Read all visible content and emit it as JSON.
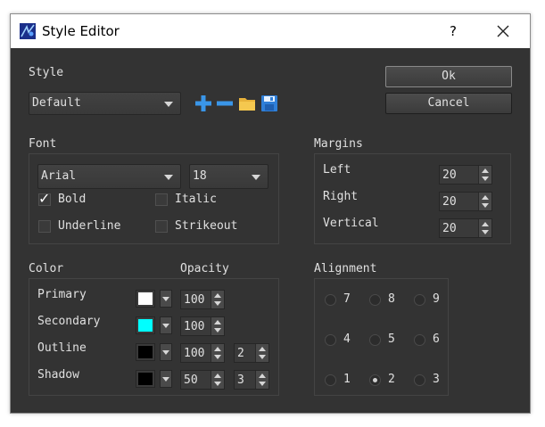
{
  "window": {
    "title": "Style Editor",
    "help_label": "?"
  },
  "style": {
    "label": "Style",
    "selected": "Default",
    "icons": [
      "add-icon",
      "remove-icon",
      "folder-icon",
      "save-icon"
    ]
  },
  "buttons": {
    "ok": "Ok",
    "cancel": "Cancel"
  },
  "font": {
    "label": "Font",
    "family": "Arial",
    "size": "18",
    "bold": {
      "label": "Bold",
      "checked": true
    },
    "italic": {
      "label": "Italic",
      "checked": false
    },
    "underline": {
      "label": "Underline",
      "checked": false
    },
    "strikeout": {
      "label": "Strikeout",
      "checked": false
    }
  },
  "margins": {
    "label": "Margins",
    "left": {
      "label": "Left",
      "value": "20"
    },
    "right": {
      "label": "Right",
      "value": "20"
    },
    "vertical": {
      "label": "Vertical",
      "value": "20"
    }
  },
  "color": {
    "label": "Color",
    "opacity_label": "Opacity",
    "primary": {
      "label": "Primary",
      "swatch": "#ffffff",
      "opacity": "100"
    },
    "secondary": {
      "label": "Secondary",
      "swatch": "#00ffff",
      "opacity": "100"
    },
    "outline": {
      "label": "Outline",
      "swatch": "#000000",
      "opacity": "100",
      "width": "2"
    },
    "shadow": {
      "label": "Shadow",
      "swatch": "#000000",
      "opacity": "50",
      "width": "3"
    }
  },
  "alignment": {
    "label": "Alignment",
    "options": [
      "7",
      "8",
      "9",
      "4",
      "5",
      "6",
      "1",
      "2",
      "3"
    ],
    "selected": "2"
  }
}
